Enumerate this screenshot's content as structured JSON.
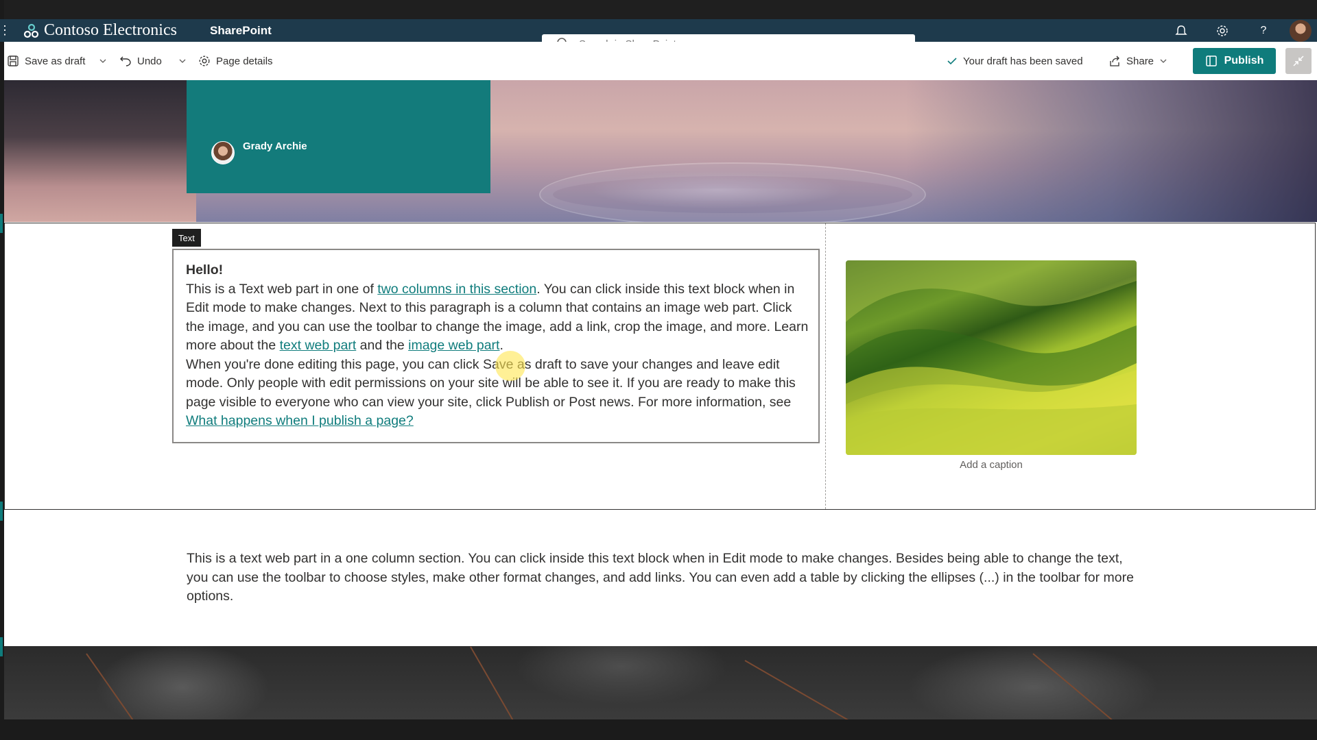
{
  "suite": {
    "brand": "Contoso Electronics",
    "app": "SharePoint",
    "search_placeholder": "Search in SharePoint"
  },
  "commandbar": {
    "save_as_draft": "Save as draft",
    "undo": "Undo",
    "page_details": "Page details",
    "draft_status": "Your draft has been saved",
    "share": "Share",
    "publish": "Publish"
  },
  "hero": {
    "author": "Grady Archie"
  },
  "section1": {
    "tag": "Text",
    "heading": "Hello!",
    "p1_a": "This is a Text web part in one of ",
    "p1_link1": "two columns in this section",
    "p1_b": ". You can click inside this text block when in Edit mode to make changes. Next to this paragraph is a column that contains an image web part. Click the image, and you can use the toolbar to change the image, add a link, crop the image, and more. Learn more about the ",
    "p1_link2": "text web part",
    "p1_c": " and the ",
    "p1_link3": "image web part",
    "p1_d": ".",
    "p2_a": "When you're done editing this page, you can click Save as draft to save your changes and leave edit mode. Only people with edit permissions on your site will be able to see it. If you are ready to make this page visible to everyone who can view your site, click Publish or Post news. For more information, see ",
    "p2_link": "What happens when I publish a page? ",
    "image_caption": "Add a caption"
  },
  "section2": {
    "text": "This is a text web part in a one column section. You can click inside this text block when in Edit mode to make changes. Besides being able to change the text, you can use the toolbar to choose styles, make other format changes, and add links. You can even add a table by clicking the ellipses (...) in the toolbar for more options."
  },
  "colors": {
    "suitebar": "#1e3a4c",
    "accent": "#0f7c7c",
    "title_box": "#137b7b"
  }
}
